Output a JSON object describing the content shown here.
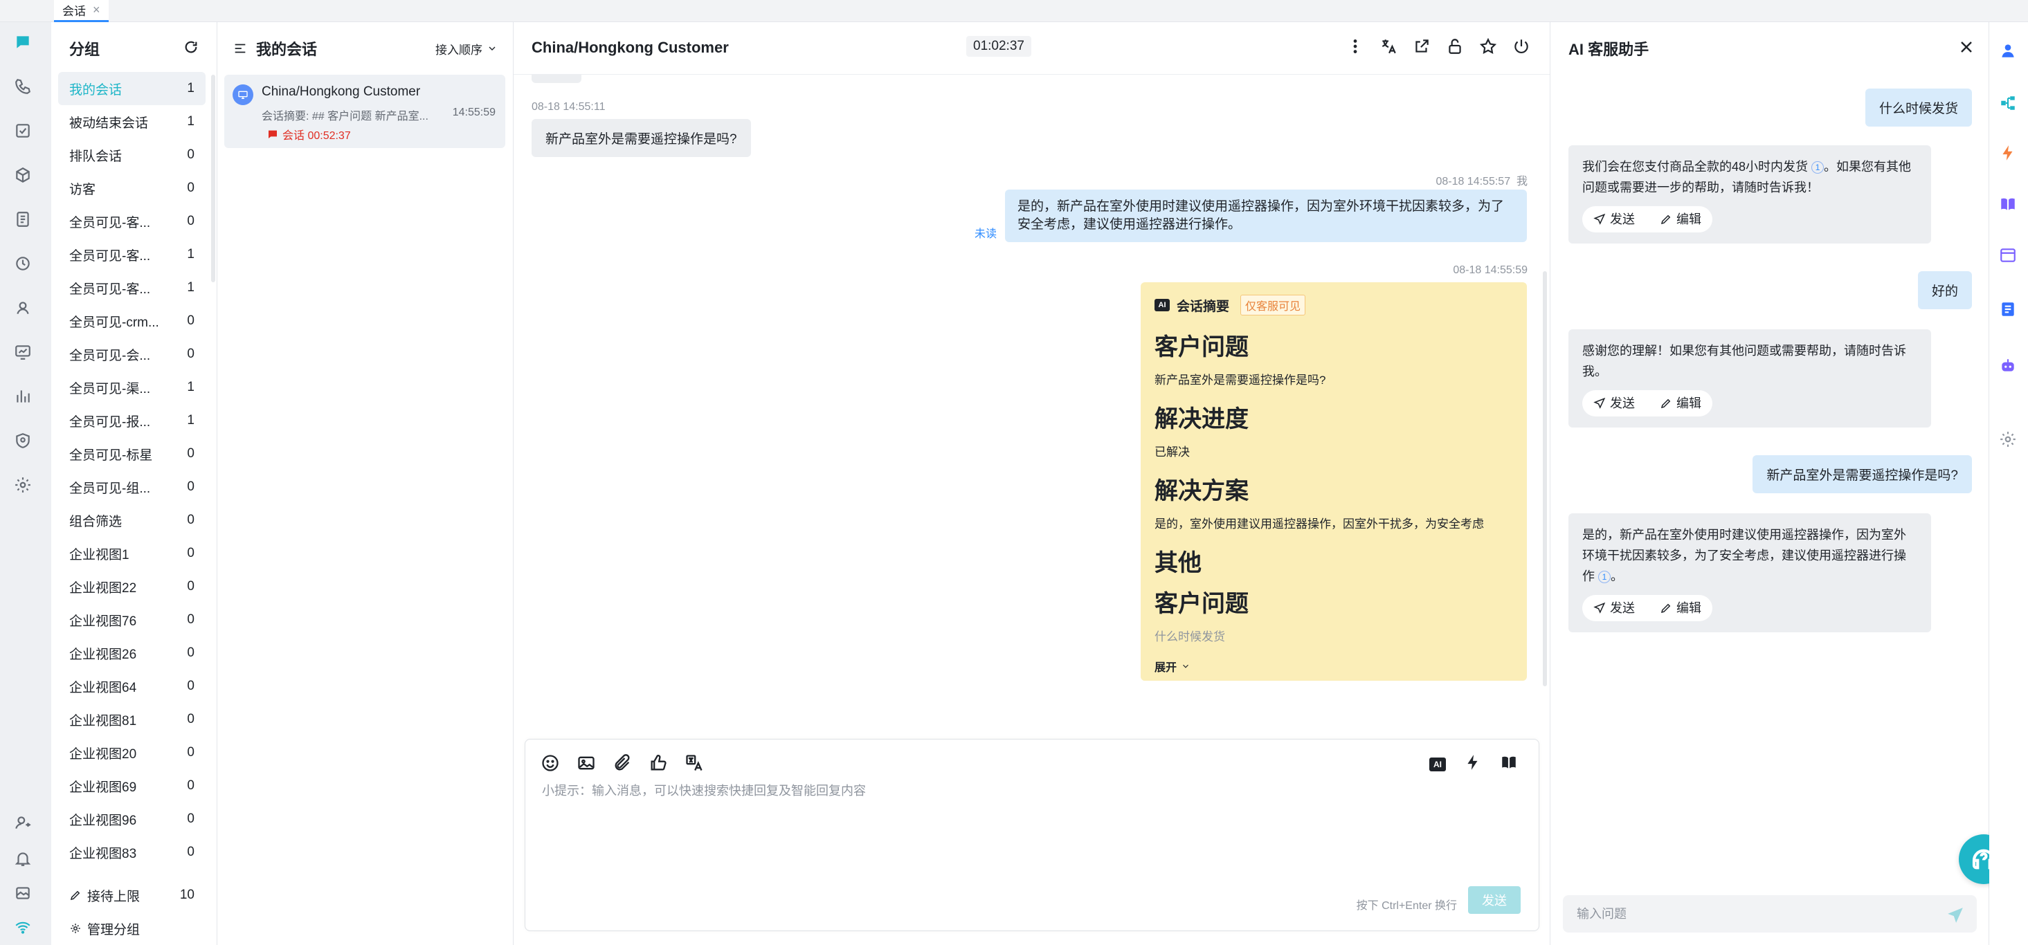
{
  "top_tab": {
    "label": "会话",
    "close": "×"
  },
  "groups": {
    "title": "分组",
    "items": [
      {
        "label": "我的会话",
        "count": "1"
      },
      {
        "label": "被动结束会话",
        "count": "1"
      },
      {
        "label": "排队会话",
        "count": "0"
      },
      {
        "label": "访客",
        "count": "0"
      },
      {
        "label": "全员可见-客...",
        "count": "0"
      },
      {
        "label": "全员可见-客...",
        "count": "1"
      },
      {
        "label": "全员可见-客...",
        "count": "1"
      },
      {
        "label": "全员可见-crm...",
        "count": "0"
      },
      {
        "label": "全员可见-会...",
        "count": "0"
      },
      {
        "label": "全员可见-渠...",
        "count": "1"
      },
      {
        "label": "全员可见-报...",
        "count": "1"
      },
      {
        "label": "全员可见-标星",
        "count": "0"
      },
      {
        "label": "全员可见-组...",
        "count": "0"
      },
      {
        "label": "组合筛选",
        "count": "0"
      },
      {
        "label": "企业视图1",
        "count": "0"
      },
      {
        "label": "企业视图22",
        "count": "0"
      },
      {
        "label": "企业视图76",
        "count": "0"
      },
      {
        "label": "企业视图26",
        "count": "0"
      },
      {
        "label": "企业视图64",
        "count": "0"
      },
      {
        "label": "企业视图81",
        "count": "0"
      },
      {
        "label": "企业视图20",
        "count": "0"
      },
      {
        "label": "企业视图69",
        "count": "0"
      },
      {
        "label": "企业视图96",
        "count": "0"
      },
      {
        "label": "企业视图83",
        "count": "0"
      }
    ],
    "reception_limit_label": "接待上限",
    "reception_limit_value": "10",
    "manage_label": "管理分组"
  },
  "conversations": {
    "title": "我的会话",
    "order_label": "接入顺序",
    "items": [
      {
        "name": "China/Hongkong Customer",
        "summary": "会话摘要: ## 客户问题 新产品室...",
        "time": "14:55:59",
        "badge": "会话 00:52:37"
      }
    ]
  },
  "chat": {
    "title": "China/Hongkong Customer",
    "timer": "01:02:37",
    "messages": {
      "m1_time": "08-18 14:55:11",
      "m1_text": "新产品室外是需要遥控操作是吗?",
      "m2_time": "08-18 14:55:57",
      "m2_sender": "我",
      "m2_text": "是的，新产品在室外使用时建议使用遥控器操作，因为室外环境干扰因素较多，为了安全考虑，建议使用遥控器进行操作。",
      "m2_status": "未读",
      "m3_time": "08-18 14:55:59"
    },
    "summary": {
      "ai_chip": "AI",
      "title": "会话摘要",
      "visibility": "仅客服可见",
      "h1": "客户问题",
      "p1": "新产品室外是需要遥控操作是吗?",
      "h2": "解决进度",
      "p2": "已解决",
      "h3": "解决方案",
      "p3": "是的，室外使用建议用遥控器操作，因室外干扰多，为安全考虑",
      "h4": "其他",
      "h5": "客户问题",
      "p5": "什么时候发货",
      "expand": "展开"
    },
    "composer": {
      "placeholder": "小提示：输入消息，可以快速搜索快捷回复及智能回复内容",
      "ai_chip": "AI",
      "hint": "按下 Ctrl+Enter 换行",
      "send": "发送"
    }
  },
  "assistant": {
    "title": "AI 客服助手",
    "q1": "什么时候发货",
    "a1": "我们会在您支付商品全款的48小时内发货",
    "a1_tail": "。如果您有其他问题或需要进一步的帮助，请随时告诉我！",
    "q2": "好的",
    "a2": "感谢您的理解！如果您有其他问题或需要帮助，请随时告诉我。",
    "q3": "新产品室外是需要遥控操作是吗?",
    "a3": "是的，新产品在室外使用时建议使用遥控器操作，因为室外环境干扰因素较多，为了安全考虑，建议使用遥控器进行操作",
    "a3_tail": "。",
    "cite": "1",
    "send_label": "发送",
    "edit_label": "编辑",
    "input_placeholder": "输入问题"
  },
  "colors": {
    "accent": "#1fb6c8",
    "user_bubble": "#d8ebfb",
    "summary_bg": "#fbeeb8",
    "alert": "#e02e24"
  }
}
